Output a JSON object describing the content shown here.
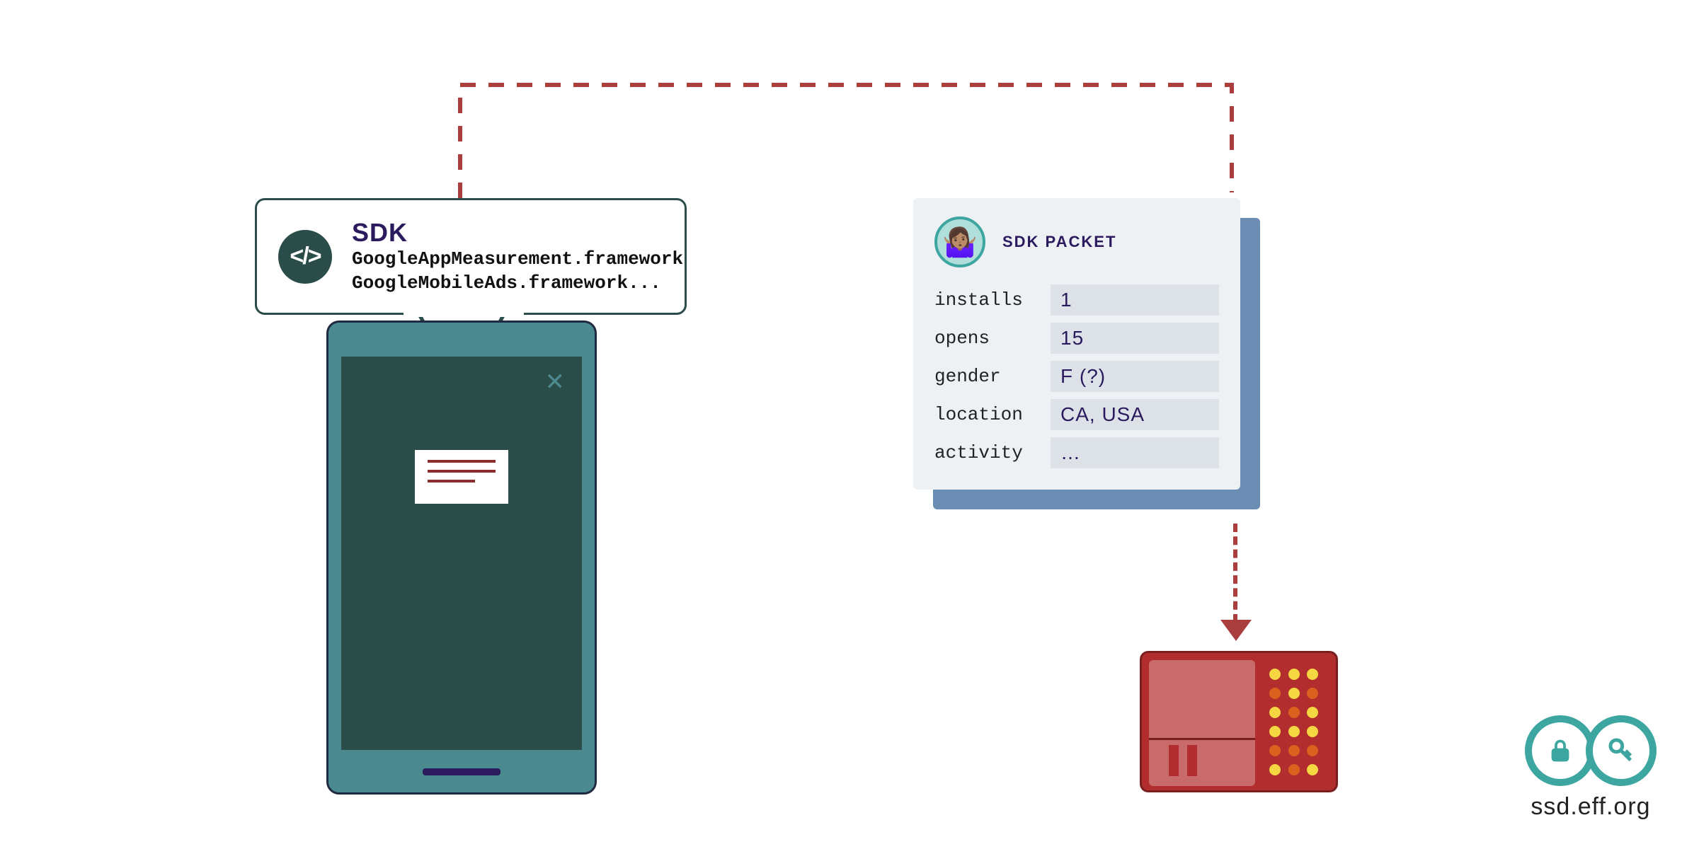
{
  "sdk_callout": {
    "title": "SDK",
    "line1": "GoogleAppMeasurement.framework",
    "line2": "GoogleMobileAds.framework...",
    "icon_glyph": "</>"
  },
  "phone": {
    "close_glyph": "✕"
  },
  "packet": {
    "title": "SDK PACKET",
    "avatar_emoji": "🤷🏽‍♀️",
    "rows": [
      {
        "label": "installs",
        "value": "1"
      },
      {
        "label": "opens",
        "value": "15"
      },
      {
        "label": "gender",
        "value": "F (?)"
      },
      {
        "label": "location",
        "value": "CA, USA"
      },
      {
        "label": "activity",
        "value": "…"
      }
    ]
  },
  "brand": {
    "url": "ssd.eff.org"
  },
  "colors": {
    "dark_teal": "#2a4d4a",
    "teal": "#4a8a8e",
    "accent_teal": "#3da6a0",
    "navy": "#2b1b5e",
    "dash_red": "#aa3d3d",
    "server_red": "#b22e2e"
  }
}
